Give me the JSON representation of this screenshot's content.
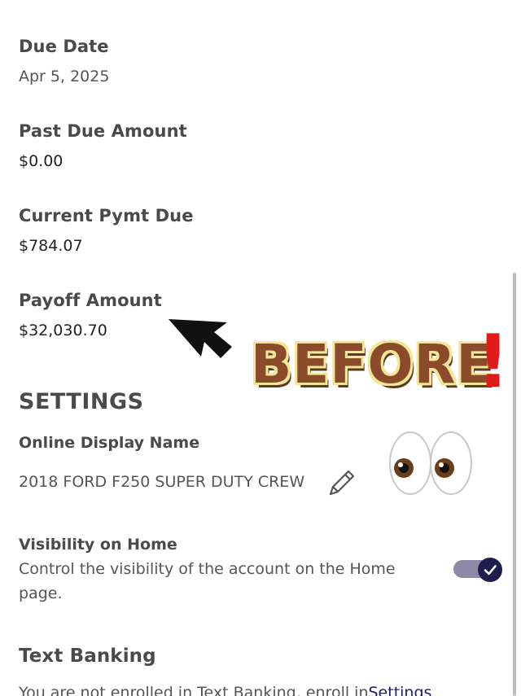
{
  "summary": {
    "due_date_label": "Due Date",
    "due_date_value": "Apr 5, 2025",
    "past_due_label": "Past Due Amount",
    "past_due_value": "$0.00",
    "current_pymt_label": "Current Pymt Due",
    "current_pymt_value": "$784.07",
    "payoff_label": "Payoff Amount",
    "payoff_value": "$32,030.70"
  },
  "settings": {
    "title": "SETTINGS",
    "display_name_label": "Online Display Name",
    "display_name_value": "2018 FORD F250 SUPER DUTY CREW",
    "visibility_label": "Visibility on Home",
    "visibility_description": "Control the visibility of the account on the Home page.",
    "visibility_enabled": true
  },
  "text_banking": {
    "title": "Text Banking",
    "message": "You are not enrolled in Text Banking, enroll in",
    "link_label": "Settings"
  },
  "overlay": {
    "before_text": "BEFORE",
    "exclamation": "!",
    "eyes": "👀"
  },
  "colors": {
    "accent": "#1f1c4e",
    "toggle_track": "#8e8aa8",
    "sticker_fill": "#8b4a2a",
    "sticker_outline": "#f1e79a",
    "exclamation": "#e01b1b"
  }
}
